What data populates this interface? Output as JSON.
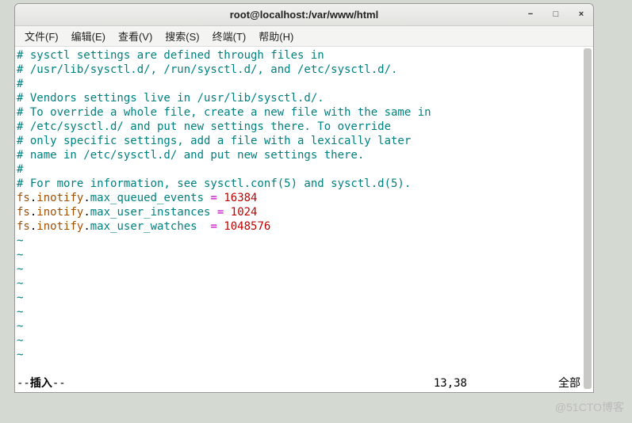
{
  "window": {
    "title": "root@localhost:/var/www/html"
  },
  "controls": {
    "minimize": "−",
    "maximize": "□",
    "close": "×"
  },
  "menu": {
    "file": "文件(F)",
    "edit": "编辑(E)",
    "view": "查看(V)",
    "search": "搜索(S)",
    "terminal": "终端(T)",
    "help": "帮助(H)"
  },
  "content": {
    "comments": [
      "# sysctl settings are defined through files in",
      "# /usr/lib/sysctl.d/, /run/sysctl.d/, and /etc/sysctl.d/.",
      "#",
      "# Vendors settings live in /usr/lib/sysctl.d/.",
      "# To override a whole file, create a new file with the same in",
      "# /etc/sysctl.d/ and put new settings there. To override",
      "# only specific settings, add a file with a lexically later",
      "# name in /etc/sysctl.d/ and put new settings there.",
      "#",
      "# For more information, see sysctl.conf(5) and sysctl.d(5)."
    ],
    "settings": [
      {
        "prefix": "fs",
        "d1": ".",
        "mid": "inotify",
        "d2": ".",
        "key": "max_queued_events",
        "eq": "= ",
        "val": "16384"
      },
      {
        "prefix": "fs",
        "d1": ".",
        "mid": "inotify",
        "d2": ".",
        "key": "max_user_instances",
        "eq": "= ",
        "val": "1024"
      },
      {
        "prefix": "fs",
        "d1": ".",
        "mid": "inotify",
        "d2": ".",
        "key": "max_user_watches",
        "eq": "= ",
        "val": "1048576"
      }
    ],
    "tilde": "~"
  },
  "status": {
    "dashes1": "-- ",
    "mode": "插入",
    "dashes2": " --",
    "pos": "13,38",
    "all": "全部"
  },
  "watermark": "@51CTO博客"
}
